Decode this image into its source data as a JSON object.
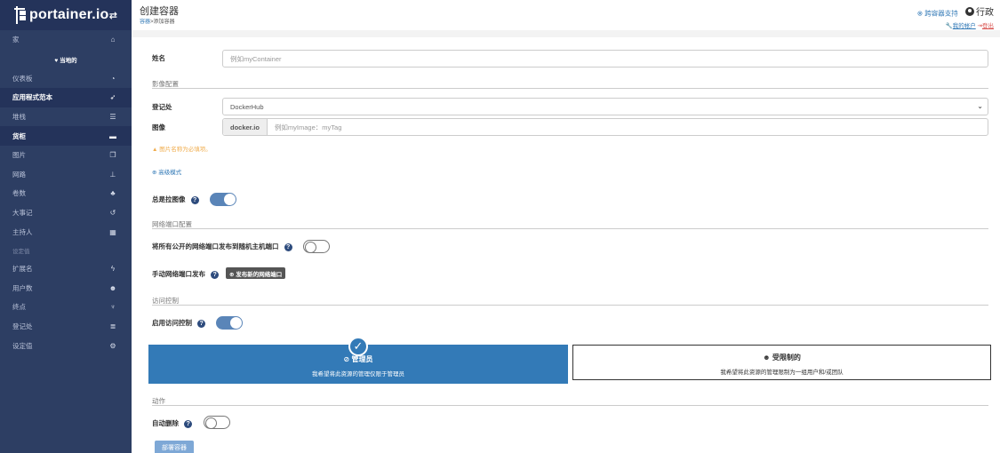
{
  "sidebar": {
    "logo": "portainer.io",
    "toggle_icon": "exchange-icon",
    "home": {
      "label": "家",
      "icon": "home-icon"
    },
    "endpoint": "♥ 当地的",
    "items": [
      {
        "label": "仪表板",
        "icon": "dashboard-icon"
      },
      {
        "label": "应用程式范本",
        "icon": "rocket-icon",
        "active": true
      },
      {
        "label": "堆栈",
        "icon": "th-list-icon"
      },
      {
        "label": "货柜",
        "icon": "server-icon",
        "active": true
      },
      {
        "label": "图片",
        "icon": "clone-icon"
      },
      {
        "label": "网路",
        "icon": "sitemap-icon"
      },
      {
        "label": "卷数",
        "icon": "cubes-icon"
      },
      {
        "label": "大事记",
        "icon": "history-icon"
      },
      {
        "label": "主持人",
        "icon": "th-icon"
      }
    ],
    "settings_section": "设定值",
    "settings_items": [
      {
        "label": "扩展名",
        "icon": "bolt-icon"
      },
      {
        "label": "用户数",
        "icon": "users-icon"
      },
      {
        "label": "终点",
        "icon": "plug-icon"
      },
      {
        "label": "登记处",
        "icon": "database-icon"
      },
      {
        "label": "设定值",
        "icon": "cogs-icon"
      }
    ]
  },
  "header": {
    "title": "创建容器",
    "breadcrumb_link": "容器",
    "breadcrumb_sep": ">",
    "breadcrumb_current": "添加容器",
    "support": "⊗ 跨容器支持",
    "user": "行政",
    "my_account": "我的帐户",
    "logout": "登出"
  },
  "form": {
    "name_label": "姓名",
    "name_placeholder": "例如myContainer",
    "image_section": "影像配置",
    "registry_label": "登记处",
    "registry_value": "DockerHub",
    "image_label": "图像",
    "image_prefix": "docker.io",
    "image_placeholder": "例如myImage：myTag",
    "image_warning": "▲ 图片名称为必填项。",
    "advanced_mode": "⊕ 高级模式",
    "always_pull_label": "总是拉图像",
    "always_pull": true,
    "network_section": "网络端口配置",
    "publish_all_label": "将所有公开的网络端口发布到随机主机端口",
    "publish_all": false,
    "manual_publish_label": "手动网络端口发布",
    "publish_new_button": "⊕ 发布新的网络端口",
    "access_section": "访问控制",
    "enable_access_label": "启用访问控制",
    "enable_access": true,
    "admin_title": "管理员",
    "admin_desc": "我希望将此资源的管理仅限于管理员",
    "restricted_title": "受限制的",
    "restricted_desc": "我希望将此资源的管理限制为一组用户和/或团队",
    "actions_section": "动作",
    "auto_remove_label": "自动删除",
    "auto_remove": false,
    "deploy_button": "部署容器"
  }
}
